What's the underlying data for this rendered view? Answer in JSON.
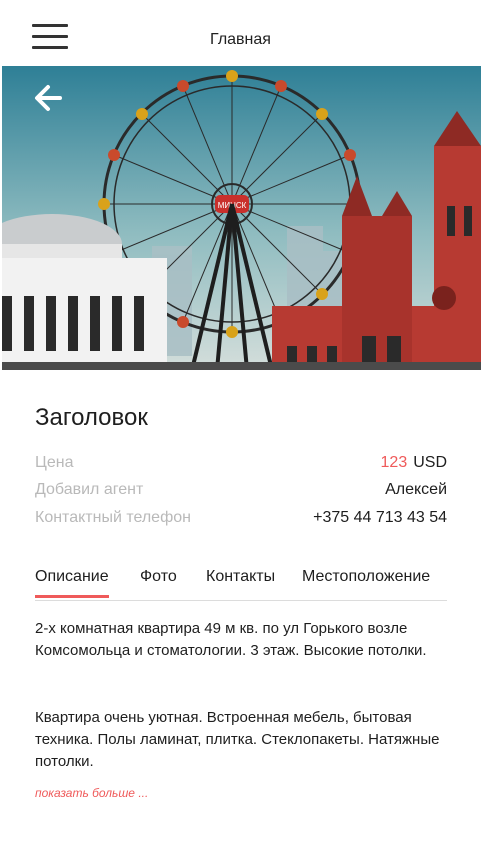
{
  "header": {
    "title": "Главная",
    "menu_icon": "hamburger-menu-icon"
  },
  "hero": {
    "image": "minsk-ferris-wheel-illustration",
    "back_icon": "arrow-left-icon",
    "sign_text": "МИНСК"
  },
  "listing": {
    "title": "Заголовок",
    "price_label": "Цена",
    "price_value": "123",
    "price_currency": "USD",
    "agent_label": "Добавил агент",
    "agent_value": "Алексей",
    "phone_label": "Контактный телефон",
    "phone_value": "+375 44 713 43 54"
  },
  "tabs": [
    {
      "label": "Описание",
      "active": true
    },
    {
      "label": "Фото",
      "active": false
    },
    {
      "label": "Контакты",
      "active": false
    },
    {
      "label": "Местоположение",
      "active": false
    }
  ],
  "description": {
    "paragraph1": "2-х комнатная квартира 49 м кв. по ул Горького возле Комсомольца и стоматологии. 3 этаж. Высокие потолки.",
    "paragraph2": "Квартира очень уютная. Встроенная мебель, бытовая техника. Полы ламинат, плитка. Стеклопакеты. Натяжные потолки.",
    "show_more": "показать больше ..."
  },
  "colors": {
    "accent": "#ef5a5a",
    "label_gray": "#b9b9b9",
    "text": "#1e1e1e"
  }
}
